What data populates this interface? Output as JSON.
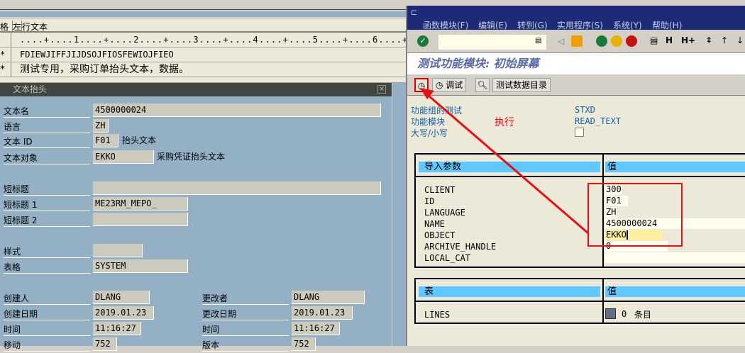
{
  "left": {
    "header": {
      "col1": "格",
      "col2": "左",
      "col3": "行文本"
    },
    "rows": [
      {
        "marker": "",
        "text": "....+....1....+....2....+....3....+....4....+....5....+....6....+..."
      },
      {
        "marker": "*",
        "text": "FDIEWJIFFJIJDSOJFIOSFEWIOJFIEO"
      },
      {
        "marker": "*",
        "text": "测试专用，采购订单抬头文本，数据。"
      }
    ],
    "dialog_title": "文本抬头",
    "fields": {
      "text_name": {
        "label": "文本名",
        "value": "4500000024"
      },
      "language": {
        "label": "语言",
        "value": "ZH"
      },
      "text_id": {
        "label": "文本 ID",
        "value": "F01",
        "desc": "抬头文本"
      },
      "text_object": {
        "label": "文本对象",
        "value": "EKKO",
        "desc": "采购凭证抬头文本"
      },
      "short_title": {
        "label": "短标题",
        "value": ""
      },
      "short_title1": {
        "label": "短标题 1",
        "value": "ME23RM_MEPO_"
      },
      "short_title2": {
        "label": "短标题 2",
        "value": ""
      },
      "style": {
        "label": "样式",
        "value": ""
      },
      "form": {
        "label": "表格",
        "value": "SYSTEM"
      },
      "created_by": {
        "label": "创建人",
        "value": "DLANG"
      },
      "created_date": {
        "label": "创建日期",
        "value": "2019.01.23"
      },
      "created_time": {
        "label": "时间",
        "value": "11:16:27"
      },
      "move": {
        "label": "移动",
        "value": "752"
      },
      "changed_by": {
        "label": "更改者",
        "value": "DLANG"
      },
      "changed_date": {
        "label": "更改日期",
        "value": "2019.01.23"
      },
      "changed_time": {
        "label": "时间",
        "value": "11:16:27"
      },
      "version": {
        "label": "版本",
        "value": "752"
      }
    }
  },
  "right": {
    "menu": [
      "函数模块(F)",
      "编辑(E)",
      "转到(G)",
      "实用程序(S)",
      "系统(Y)",
      "帮助(H)"
    ],
    "command_field": "",
    "screen_title": "测试功能模块: 初始屏幕",
    "app_toolbar": {
      "debug": "调试",
      "test_data": "测试数据目录"
    },
    "annotation": "执行",
    "info": {
      "group_label": "功能组的测试",
      "group_value": "STXD",
      "fm_label": "功能模块",
      "fm_value": "READ_TEXT",
      "case_label": "大写/小写"
    },
    "import": {
      "header_param": "导入参数",
      "header_value": "值",
      "params": [
        {
          "name": "CLIENT",
          "value": "300"
        },
        {
          "name": "ID",
          "value": "F01"
        },
        {
          "name": "LANGUAGE",
          "value": "ZH"
        },
        {
          "name": "NAME",
          "value": "4500000024"
        },
        {
          "name": "OBJECT",
          "value": "EKKO"
        },
        {
          "name": "ARCHIVE_HANDLE",
          "value": "0"
        },
        {
          "name": "LOCAL_CAT",
          "value": ""
        }
      ]
    },
    "tables": {
      "header_param": "表",
      "header_value": "值",
      "name": "LINES",
      "count": "0",
      "unit": "条目"
    }
  },
  "colors": {
    "annotation": "#ff0000",
    "header_band": "#5fc8ff",
    "title_bar": "#1c2a78"
  }
}
